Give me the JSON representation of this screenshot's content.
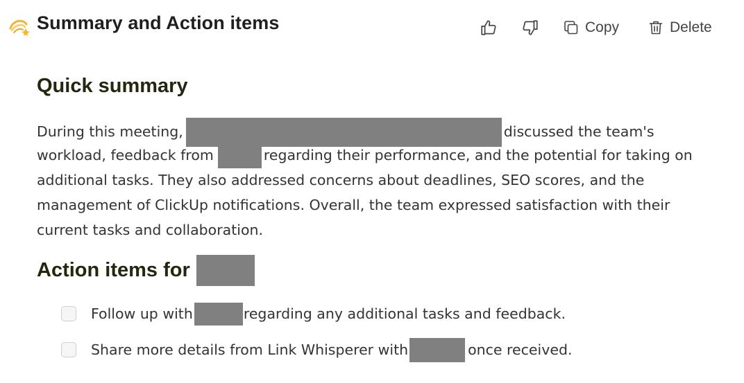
{
  "header": {
    "emoji": "💫",
    "title": "Summary and Action items",
    "actions": {
      "like_icon": "thumbs-up-icon",
      "dislike_icon": "thumbs-down-icon",
      "copy_label": "Copy",
      "delete_label": "Delete"
    }
  },
  "summary": {
    "heading": "Quick summary",
    "line1_a": "During this meeting,",
    "line1_b": "discussed the team's",
    "line2_a": "workload, feedback from",
    "line2_b": "regarding their performance, and the potential for taking on",
    "line3": "additional tasks. They also addressed concerns about deadlines, SEO scores, and the",
    "line4": "management of ClickUp notifications. Overall, the team expressed satisfaction with their",
    "line5": "current tasks and collaboration."
  },
  "action_items": {
    "heading": "Action items for",
    "items": [
      {
        "before": "Follow up with",
        "after": "regarding any additional tasks and feedback.",
        "checked": false
      },
      {
        "before": "Share more details from Link Whisperer with",
        "after": "once received.",
        "checked": false
      }
    ]
  },
  "colors": {
    "redaction": "#808080",
    "heading": "#26260f"
  }
}
